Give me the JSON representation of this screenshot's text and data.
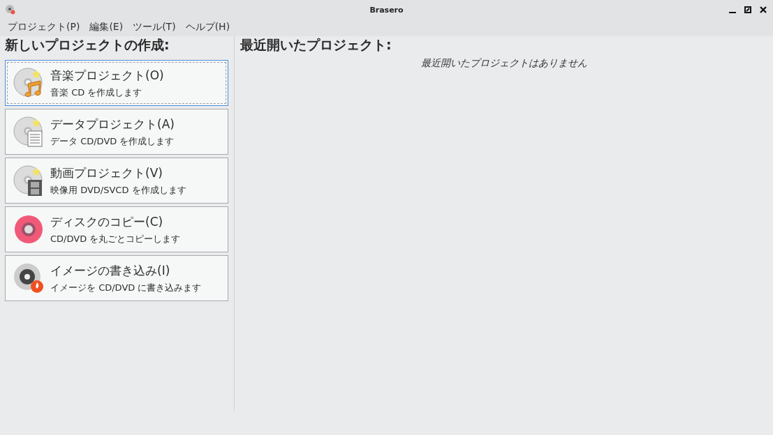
{
  "window": {
    "title": "Brasero"
  },
  "menu": [
    "プロジェクト(P)",
    "編集(E)",
    "ツール(T)",
    "ヘルプ(H)"
  ],
  "new_project": {
    "heading": "新しいプロジェクトの作成:",
    "items": [
      {
        "kind": "music",
        "title": "音楽プロジェクト(O)",
        "description": "音楽 CD を作成します",
        "selected": true
      },
      {
        "kind": "data",
        "title": "データプロジェクト(A)",
        "description": "データ CD/DVD を作成します",
        "selected": false
      },
      {
        "kind": "video",
        "title": "動画プロジェクト(V)",
        "description": "映像用 DVD/SVCD を作成します",
        "selected": false
      },
      {
        "kind": "copy",
        "title": "ディスクのコピー(C)",
        "description": "CD/DVD を丸ごとコピーします",
        "selected": false
      },
      {
        "kind": "burn",
        "title": "イメージの書き込み(I)",
        "description": "イメージを CD/DVD に書き込みます",
        "selected": false
      }
    ]
  },
  "recent": {
    "heading": "最近開いたプロジェクト:",
    "empty_message": "最近開いたプロジェクトはありません"
  }
}
